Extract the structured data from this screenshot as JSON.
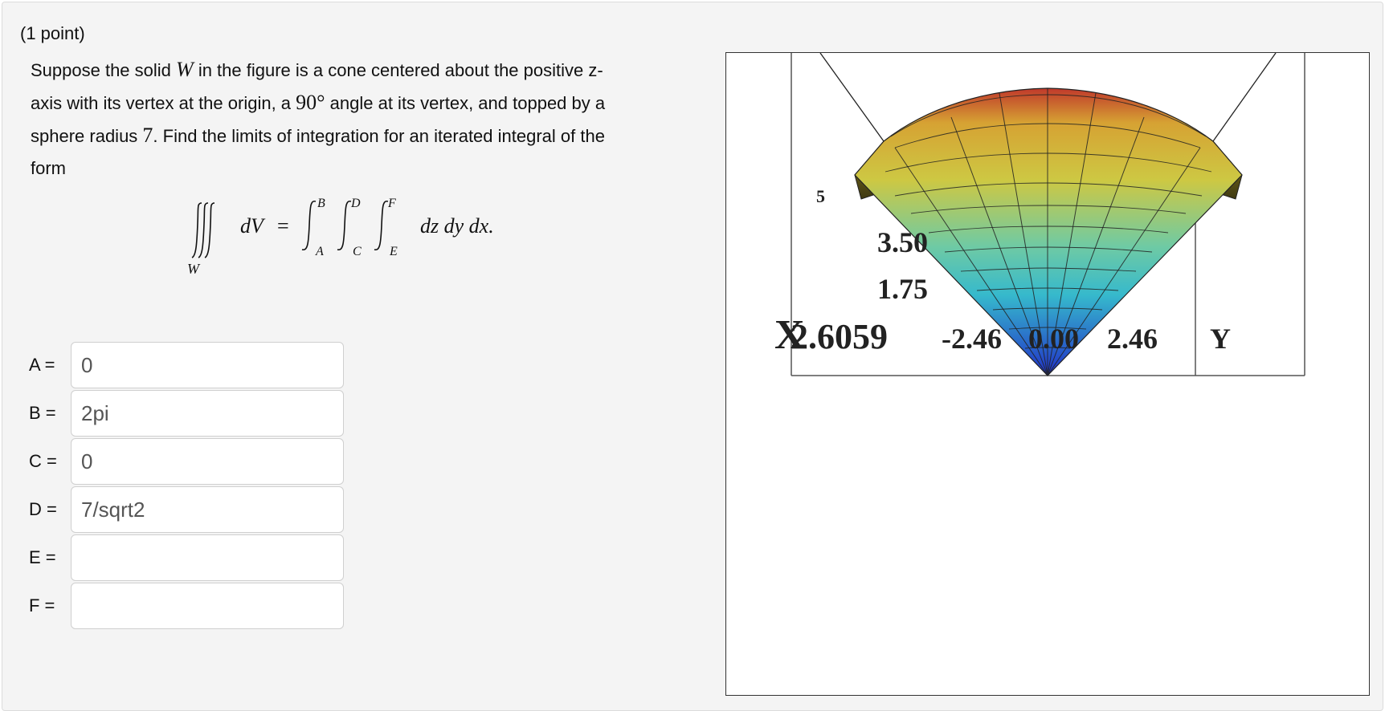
{
  "header": {
    "points": "(1 point)"
  },
  "problem": {
    "t1": "Suppose the solid ",
    "var_w": "W",
    "t2": " in the figure is a cone centered about the positive z-",
    "t3": "axis with its vertex at the origin, a ",
    "angle": "90°",
    "t4": " angle at its vertex, and topped by a",
    "t5": "sphere radius ",
    "radius": "7",
    "t6": ". Find the limits of integration for an iterated integral of the",
    "t7": "form"
  },
  "equation": {
    "region": "W",
    "lhs": "dV",
    "equals": "=",
    "limits": {
      "a": "A",
      "b": "B",
      "c": "C",
      "d": "D",
      "e": "E",
      "f": "F"
    },
    "rhs": "dz dy dx."
  },
  "answers": [
    {
      "label": "A =",
      "value": "0"
    },
    {
      "label": "B =",
      "value": "2pi"
    },
    {
      "label": "C =",
      "value": "0"
    },
    {
      "label": "D =",
      "value": "7/sqrt2"
    },
    {
      "label": "E =",
      "value": ""
    },
    {
      "label": "F =",
      "value": ""
    }
  ],
  "figure": {
    "z_ticks": [
      "3.50",
      "1.75"
    ],
    "z_partial_tick": "5",
    "x_axis_label": "X",
    "bottom_overlap_label": "2.6059",
    "y_ticks": [
      "-2.46",
      "0.00",
      "2.46"
    ],
    "y_axis_label": "Y",
    "colors": {
      "top": "#c0392b",
      "upper": "#d4c640",
      "middle": "#3cc4c4",
      "bottom": "#2233cc"
    }
  }
}
